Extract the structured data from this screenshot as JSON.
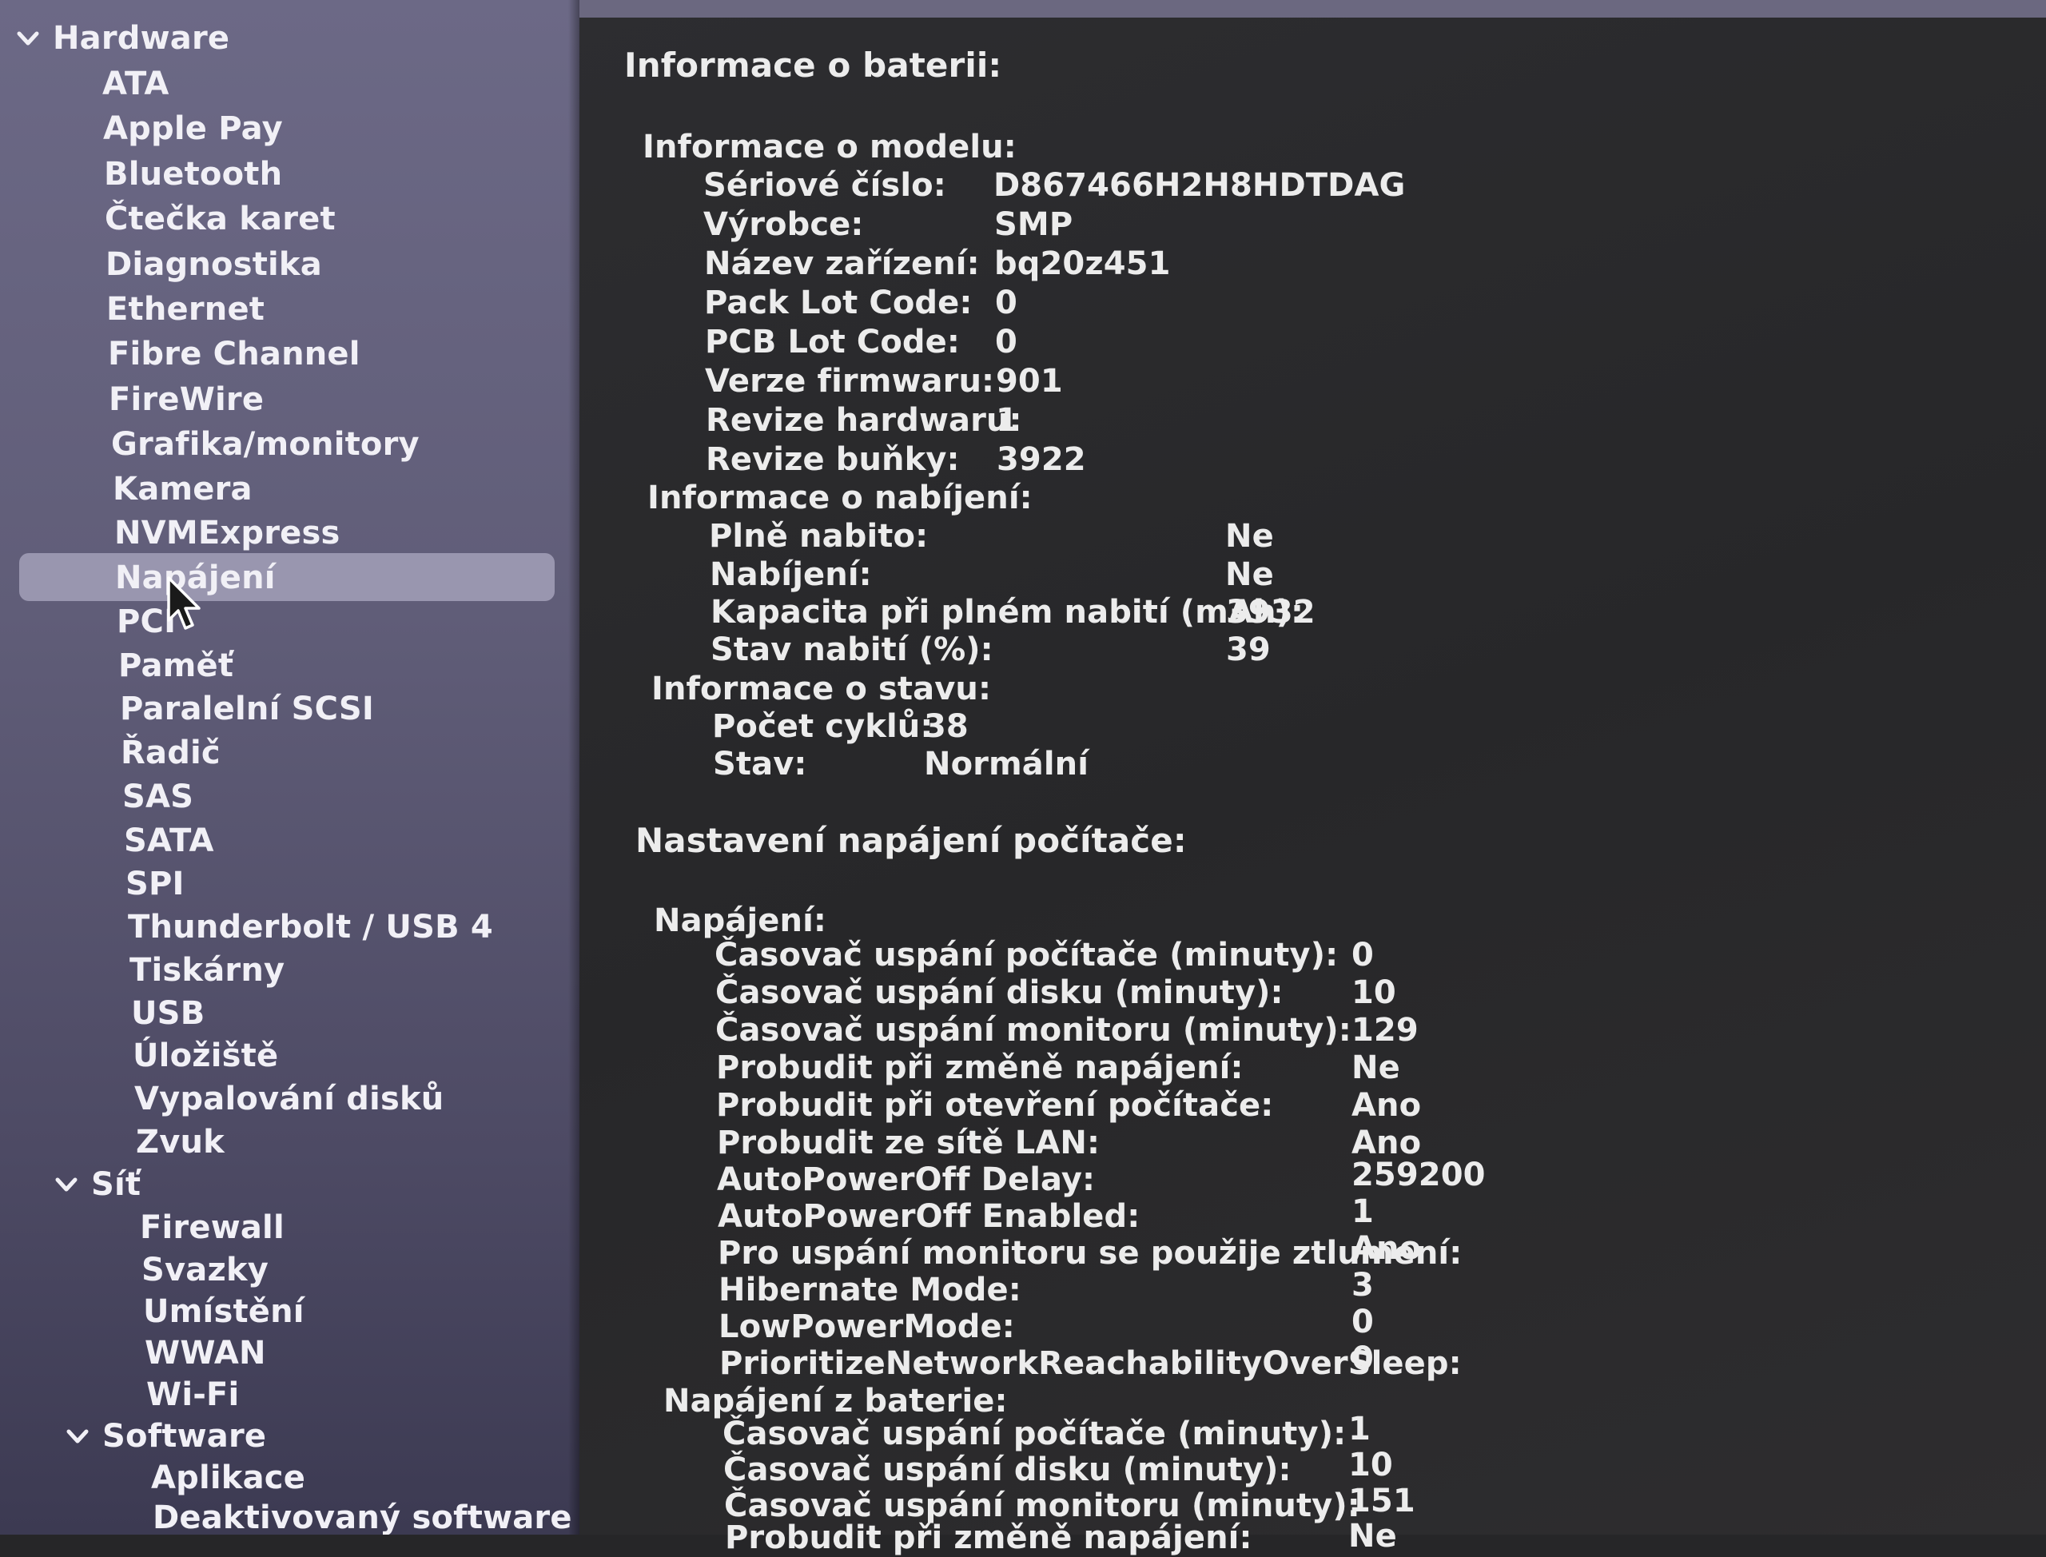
{
  "sidebar": {
    "hardware": {
      "label": "Hardware",
      "items": [
        "ATA",
        "Apple Pay",
        "Bluetooth",
        "Čtečka karet",
        "Diagnostika",
        "Ethernet",
        "Fibre Channel",
        "FireWire",
        "Grafika/monitory",
        "Kamera",
        "NVMExpress",
        "Napájení",
        "PCI",
        "Paměť",
        "Paralelní SCSI",
        "Řadič",
        "SAS",
        "SATA",
        "SPI",
        "Thunderbolt / USB 4",
        "Tiskárny",
        "USB",
        "Úložiště",
        "Vypalování disků",
        "Zvuk"
      ],
      "selected": "Napájení"
    },
    "network": {
      "label": "Síť",
      "items": [
        "Firewall",
        "Svazky",
        "Umístění",
        "WWAN",
        "Wi-Fi"
      ]
    },
    "software": {
      "label": "Software",
      "items": [
        "Aplikace",
        "Deaktivovaný software"
      ]
    }
  },
  "battery": {
    "title": "Informace o baterii:",
    "model": {
      "header": "Informace o modelu:",
      "rows": [
        {
          "label": "Sériové číslo:",
          "value": "D867466H2H8HDTDAG"
        },
        {
          "label": "Výrobce:",
          "value": "SMP"
        },
        {
          "label": "Název zařízení:",
          "value": "bq20z451"
        },
        {
          "label": "Pack Lot Code:",
          "value": "0"
        },
        {
          "label": "PCB Lot Code:",
          "value": "0"
        },
        {
          "label": "Verze firmwaru:",
          "value": "901"
        },
        {
          "label": "Revize hardwaru:",
          "value": "1"
        },
        {
          "label": "Revize buňky:",
          "value": "3922"
        }
      ]
    },
    "charge": {
      "header": "Informace o nabíjení:",
      "rows": [
        {
          "label": "Plně nabito:",
          "value": "Ne"
        },
        {
          "label": "Nabíjení:",
          "value": "Ne"
        },
        {
          "label": "Kapacita při plném nabití (mAh):",
          "value": "3932"
        },
        {
          "label": "Stav nabití (%):",
          "value": "39"
        }
      ]
    },
    "health": {
      "header": "Informace o stavu:",
      "rows": [
        {
          "label": "Počet cyklů:",
          "value": "38"
        },
        {
          "label": "Stav:",
          "value": "Normální"
        }
      ]
    }
  },
  "power": {
    "title": "Nastavení napájení počítače:",
    "ac": {
      "header": "Napájení:",
      "rows": [
        {
          "label": "Časovač uspání počítače (minuty):",
          "value": "0"
        },
        {
          "label": "Časovač uspání disku (minuty):",
          "value": "10"
        },
        {
          "label": "Časovač uspání monitoru (minuty):",
          "value": "129"
        },
        {
          "label": "Probudit při změně napájení:",
          "value": "Ne"
        },
        {
          "label": "Probudit při otevření počítače:",
          "value": "Ano"
        },
        {
          "label": "Probudit ze sítě LAN:",
          "value": "Ano"
        },
        {
          "label": "AutoPowerOff Delay:",
          "value": "259200"
        },
        {
          "label": "AutoPowerOff Enabled:",
          "value": "1"
        },
        {
          "label": "Pro uspání monitoru se použije ztlumení:",
          "value": "Ano"
        },
        {
          "label": "Hibernate Mode:",
          "value": "3"
        },
        {
          "label": "LowPowerMode:",
          "value": "0"
        },
        {
          "label": "PrioritizeNetworkReachabilityOverSleep:",
          "value": "0"
        }
      ]
    },
    "battery_power": {
      "header": "Napájení z baterie:",
      "rows": [
        {
          "label": "Časovač uspání počítače (minuty):",
          "value": "1"
        },
        {
          "label": "Časovač uspání disku (minuty):",
          "value": "10"
        },
        {
          "label": "Časovač uspání monitoru (minuty):",
          "value": "151"
        },
        {
          "label": "Probudit při změně napájení:",
          "value": "Ne"
        }
      ]
    }
  }
}
